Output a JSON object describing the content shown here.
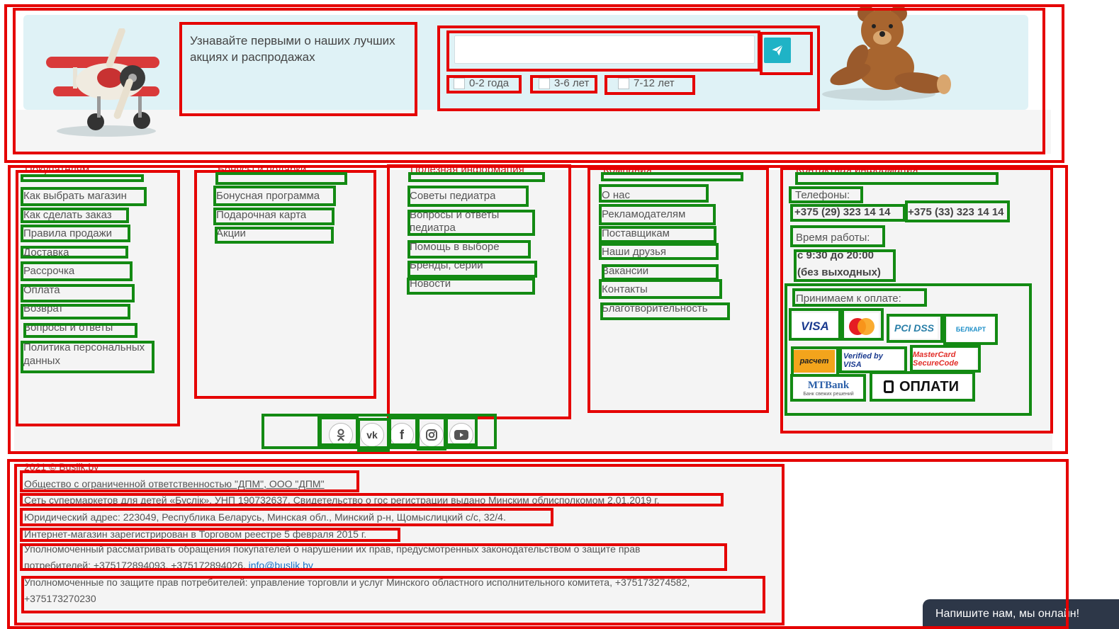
{
  "subscribe": {
    "text": "Узнавайте первыми о наших лучших акциях и распродажах",
    "email_placeholder": "",
    "ages": [
      "0-2 года",
      "3-6 лет",
      "7-12 лет"
    ]
  },
  "columns": [
    {
      "heading": "Покупателям",
      "links": [
        "Как выбрать магазин",
        "Как сделать заказ",
        "Правила продажи",
        "Доставка",
        "Рассрочка",
        "Оплата",
        "Возврат",
        "Вопросы и ответы",
        "Политика персональных данных"
      ]
    },
    {
      "heading": "Бонусы и подарки",
      "links": [
        "Бонусная программа",
        "Подарочная карта",
        "Акции"
      ]
    },
    {
      "heading": "Полезная информация",
      "links": [
        "Советы педиатра",
        "Вопросы и ответы педиатра",
        "Помощь в выборе",
        "Бренды, серии",
        "Новости"
      ]
    },
    {
      "heading": "Компания",
      "links": [
        "О нас",
        "Рекламодателям",
        "Поставщикам",
        "Наши друзья",
        "Вакансии",
        "Контакты",
        "Благотворительность"
      ]
    }
  ],
  "contacts": {
    "heading": "Контактная информация",
    "phones_label": "Телефоны:",
    "phone1": "+375 (29) 323 14 14",
    "phone2": "+375 (33) 323 14 14",
    "hours_label": "Время работы:",
    "hours_line1": "с 9:30 до 20:00",
    "hours_line2": "(без выходных)",
    "payment_label": "Принимаем к оплате:",
    "payment_logos": [
      "VISA",
      "MasterCard",
      "PCI DSS",
      "БЕЛКАРТ",
      "расчет",
      "Verified by VISA",
      "MasterCard SecureCode",
      "MTBank",
      "ОПЛАТИ"
    ],
    "mtbank_sub": "Банк свежих решений"
  },
  "social": [
    "odnoklassniki-icon",
    "vk-icon",
    "facebook-icon",
    "instagram-icon",
    "youtube-icon"
  ],
  "legal": {
    "copyright": "2021 © Buslik.by",
    "company": "Общество с ограниченной ответственностью \"ДПМ\", ООО \"ДПМ\"",
    "line1": "Сеть супермаркетов для детей «Буслік», УНП 190732637, Свидетельство о гос регистрации выдано Минским облисполкомом 2.01.2019 г.",
    "line2": "Юридический адрес: 223049, Республика Беларусь, Минская обл., Минский р-н, Щомыслицкий с/с, 32/4.",
    "line3": "Интернет-магазин зарегистрирован в Торговом реестре 5 февраля 2015 г.",
    "line4_a": "Уполномоченный рассматривать обращения покупателей о нарушении их прав, предусмотренных законодательством о защите прав",
    "line4_b": "потребителей: +375172894093, +375172894026, ",
    "email": "info@buslik.by",
    "line5_a": "Уполномоченные по защите прав потребителей: управление торговли и услуг Минского областного исполнительного комитета, +375173274582,",
    "line5_b": "+375173270230"
  },
  "chat": {
    "label": "Напишите нам, мы онлайн!"
  },
  "colors": {
    "accent": "#1fb3c6",
    "heading": "#c51a1a",
    "annotation_red": "#e50000",
    "annotation_green": "#138a13"
  }
}
